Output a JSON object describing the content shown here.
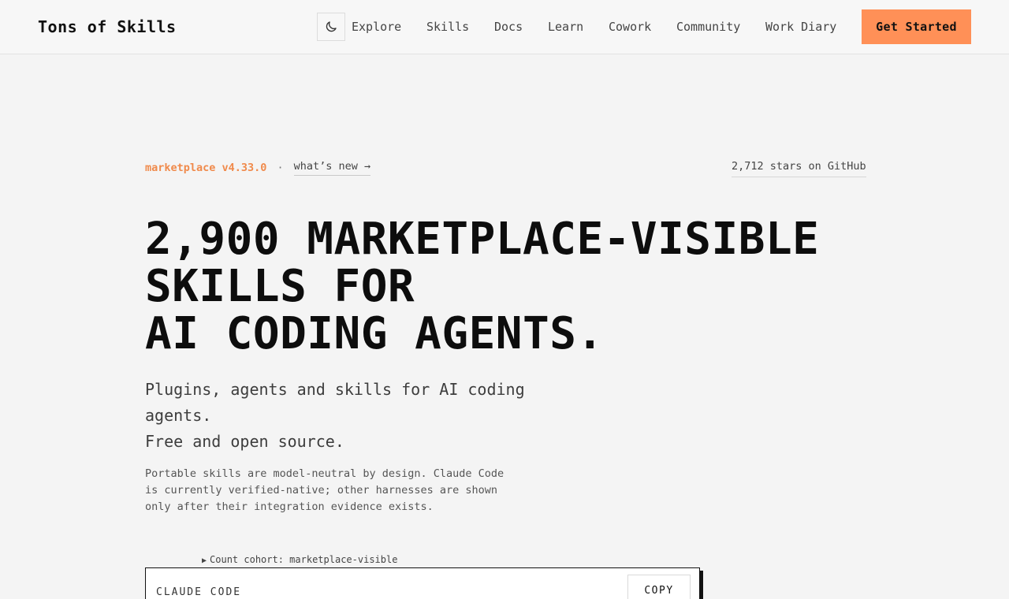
{
  "header": {
    "brand": "Tons of Skills",
    "theme_toggle_icon": "moon-icon",
    "nav": [
      {
        "label": "Explore"
      },
      {
        "label": "Skills"
      },
      {
        "label": "Docs"
      },
      {
        "label": "Learn"
      },
      {
        "label": "Cowork"
      },
      {
        "label": "Community"
      },
      {
        "label": "Work Diary"
      }
    ],
    "cta_label": "Get Started"
  },
  "hero": {
    "version": "marketplace v4.33.0",
    "separator": "·",
    "whats_new": "what’s new →",
    "stars": "2,712 stars on GitHub",
    "title_lines": [
      "2,900 MARKETPLACE-VISIBLE",
      "SKILLS FOR",
      "AI CODING AGENTS."
    ],
    "subtitle_line_1": "Plugins, agents and skills for AI coding agents.",
    "subtitle_line_2": "Free and open source.",
    "note": "Portable skills are model-neutral by design. Claude Code is currently verified-native; other harnesses are shown only after their integration evidence exists.",
    "cohort": "Count cohort: marketplace-visible",
    "cohort_icon": "triangle-right-icon"
  },
  "install": {
    "label": "CLAUDE CODE",
    "copy_label": "COPY"
  },
  "colors": {
    "accent": "#ff9057",
    "version_text": "#f08a4b",
    "background": "#f4f4f4"
  }
}
